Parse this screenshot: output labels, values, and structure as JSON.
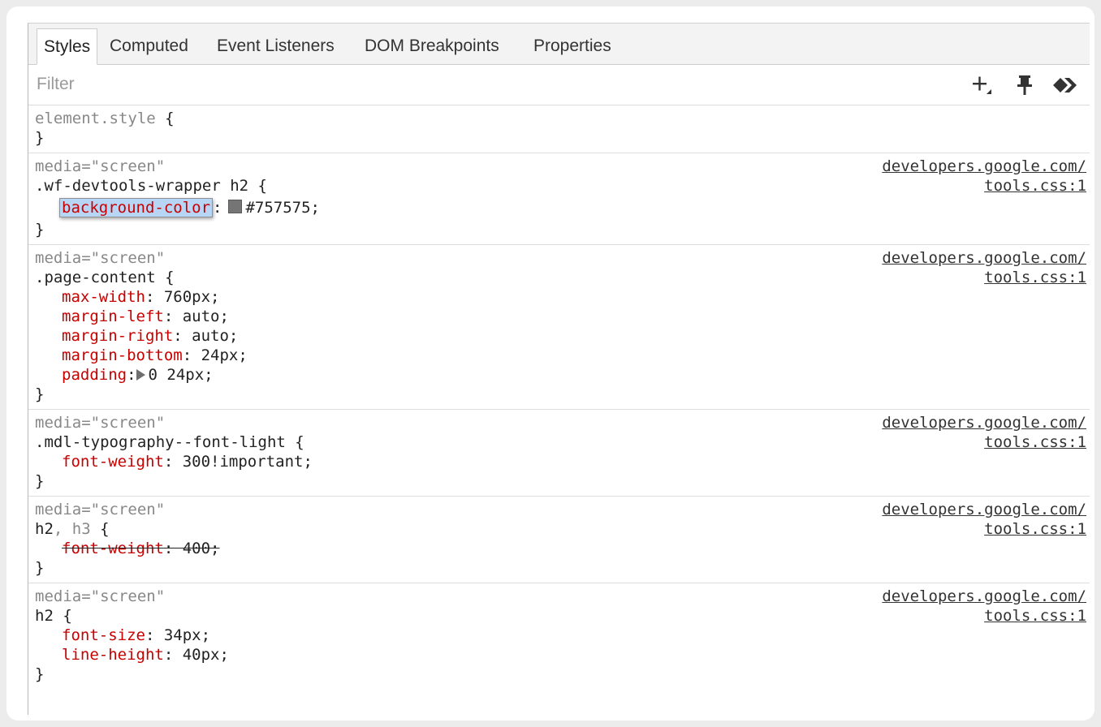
{
  "tabs": [
    {
      "label": "Styles",
      "active": true
    },
    {
      "label": "Computed",
      "active": false
    },
    {
      "label": "Event Listeners",
      "active": false
    },
    {
      "label": "DOM Breakpoints",
      "active": false
    },
    {
      "label": "Properties",
      "active": false
    }
  ],
  "filter": {
    "placeholder": "Filter",
    "value": ""
  },
  "toolbar": {
    "icons": [
      "new-style-rule-icon",
      "pin-icon",
      "toggle-element-state-icon"
    ]
  },
  "rules": {
    "element_style": {
      "selector": "element.style",
      "open": "{",
      "close": "}"
    },
    "r1": {
      "media": "media=\"screen\"",
      "selector": ".wf-devtools-wrapper h2",
      "open": " {",
      "close": "}",
      "source_line1": "developers.google.com/",
      "source_line2": "tools.css:1",
      "declarations": [
        {
          "property": "background-color",
          "value": "#757575;",
          "swatch": "#757575",
          "editing": true
        }
      ]
    },
    "r2": {
      "media": "media=\"screen\"",
      "selector": ".page-content",
      "open": " {",
      "close": "}",
      "source_line1": "developers.google.com/",
      "source_line2": "tools.css:1",
      "declarations": [
        {
          "property": "max-width",
          "value": " 760px;"
        },
        {
          "property": "margin-left",
          "value": " auto;"
        },
        {
          "property": "margin-right",
          "value": " auto;"
        },
        {
          "property": "margin-bottom",
          "value": " 24px;"
        },
        {
          "property": "padding",
          "value": "0 24px;"
        }
      ]
    },
    "r3": {
      "media": "media=\"screen\"",
      "selector": ".mdl-typography--font-light",
      "open": " {",
      "close": "}",
      "source_line1": "developers.google.com/",
      "source_line2": "tools.css:1",
      "declarations": [
        {
          "property": "font-weight",
          "value": " 300!important;"
        }
      ]
    },
    "r4": {
      "media": "media=\"screen\"",
      "selector_main": "h2",
      "selector_dim": ", h3",
      "open": " {",
      "close": "}",
      "source_line1": "developers.google.com/",
      "source_line2": "tools.css:1",
      "declarations": [
        {
          "property": "font-weight",
          "value": ": 400;",
          "overridden": true
        }
      ]
    },
    "r5": {
      "media": "media=\"screen\"",
      "selector": "h2",
      "open": " {",
      "close": "}",
      "source_line1": "developers.google.com/",
      "source_line2": "tools.css:1",
      "declarations": [
        {
          "property": "font-size",
          "value": " 34px;"
        },
        {
          "property": "line-height",
          "value": " 40px;"
        }
      ]
    }
  },
  "colors": {
    "property": "#c80000",
    "media": "#888888",
    "selection": "#b7d5f5",
    "swatch": "#757575"
  }
}
